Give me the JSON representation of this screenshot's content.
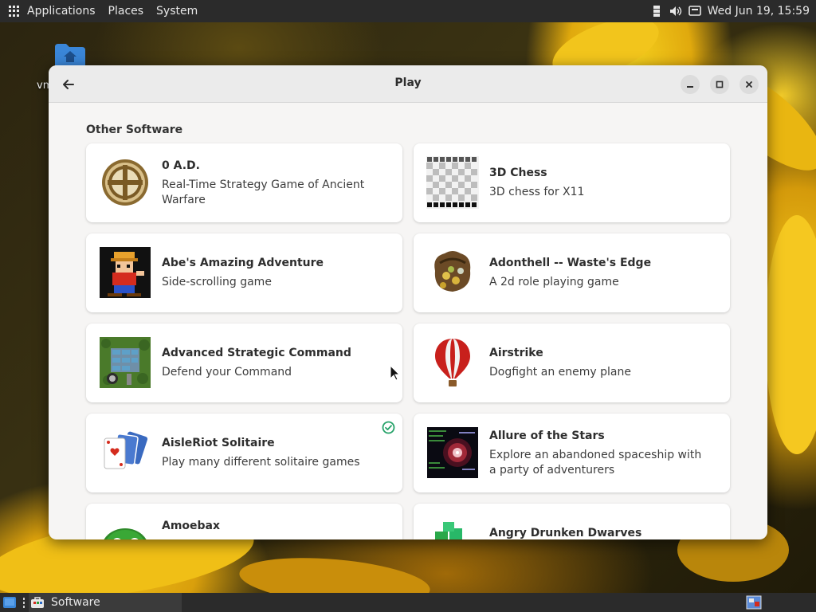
{
  "top_bar": {
    "menus": [
      "Applications",
      "Places",
      "System"
    ],
    "clock": "Wed Jun 19, 15:59"
  },
  "desktop": {
    "home_label": "vm"
  },
  "window": {
    "title": "Play",
    "section_title": "Other Software",
    "apps": [
      {
        "name": "0 A.D.",
        "summary": "Real-Time Strategy Game of Ancient Warfare",
        "icon": "0ad-icon"
      },
      {
        "name": "3D Chess",
        "summary": "3D chess for X11",
        "icon": "chess-board-icon"
      },
      {
        "name": "Abe's Amazing Adventure",
        "summary": "Side-scrolling game",
        "icon": "abe-icon"
      },
      {
        "name": "Adonthell -- Waste's Edge",
        "summary": "A 2d role playing game",
        "icon": "treasure-bag-icon"
      },
      {
        "name": "Advanced Strategic Command",
        "summary": "Defend your Command",
        "icon": "strategy-map-icon"
      },
      {
        "name": "Airstrike",
        "summary": "Dogfight an enemy plane",
        "icon": "hot-air-balloon-icon"
      },
      {
        "name": "AisleRiot Solitaire",
        "summary": "Play many different solitaire games",
        "icon": "playing-cards-icon",
        "installed": true
      },
      {
        "name": "Allure of the Stars",
        "summary": "Explore an abandoned spaceship with a party of adventurers",
        "icon": "space-vortex-icon"
      },
      {
        "name": "Amoebax",
        "summary": "",
        "icon": "amoeba-icon"
      },
      {
        "name": "Angry Drunken Dwarves",
        "summary": "",
        "icon": "gem-blocks-icon"
      }
    ]
  },
  "taskbar": {
    "software_label": "Software"
  },
  "colors": {
    "panel": "#2b2b2b",
    "window_bg": "#f6f5f4",
    "card_bg": "#ffffff",
    "installed_check": "#26a269"
  }
}
